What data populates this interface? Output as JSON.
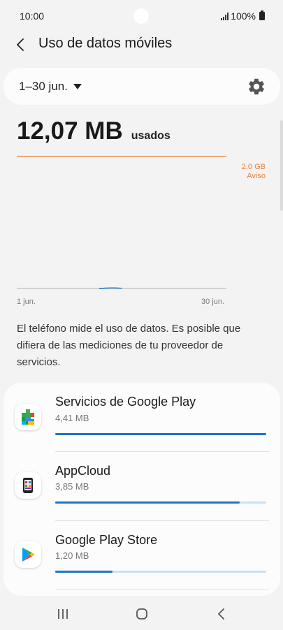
{
  "status": {
    "time": "10:00",
    "battery": "100%"
  },
  "header": {
    "title": "Uso de datos móviles"
  },
  "period": {
    "label": "1–30 jun."
  },
  "usage": {
    "amount": "12,07 MB",
    "suffix": "usados"
  },
  "chart_data": {
    "type": "line",
    "x_start": "1 jun.",
    "x_end": "30 jun.",
    "warning_value": "2,0 GB",
    "warning_label": "Aviso",
    "warning_color": "#e8833a",
    "series_color": "#1f74c4"
  },
  "info": {
    "text": "El teléfono mide el uso de datos. Es posible que difiera de las mediciones de tu proveedor de servicios."
  },
  "apps": [
    {
      "name": "Servicios de Google Play",
      "size": "4,41 MB",
      "fraction": 1.0,
      "icon": "google-play-services-icon"
    },
    {
      "name": "AppCloud",
      "size": "3,85 MB",
      "fraction": 0.873,
      "icon": "appcloud-icon"
    },
    {
      "name": "Google Play Store",
      "size": "1,20 MB",
      "fraction": 0.272,
      "icon": "google-play-store-icon"
    }
  ],
  "colors": {
    "accent": "#1f74c4",
    "bar_track": "#c9e1f6",
    "warning": "#e8833a"
  }
}
